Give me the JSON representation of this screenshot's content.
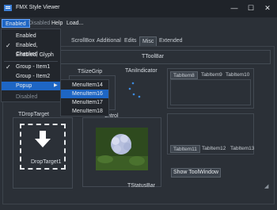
{
  "window": {
    "title": "FMX Style Viewer",
    "controls": {
      "minimize": "—",
      "maximize": "☐",
      "close": "✕"
    }
  },
  "menubar": [
    {
      "label": "Enabled"
    },
    {
      "label": "Disabled"
    },
    {
      "label": "Help"
    },
    {
      "label": "Load..."
    }
  ],
  "dropdown": {
    "items": [
      {
        "label": "Enabled",
        "checked": false
      },
      {
        "label": "Enabled, Checked",
        "checked": true
      },
      {
        "label": "Enabled, Glyph",
        "checked": false
      },
      {
        "label": "Group - Item1",
        "checked": true
      },
      {
        "label": "Group - Item2",
        "checked": false
      },
      {
        "label": "Popup",
        "arrow": "▶"
      },
      {
        "label": "Disabled"
      }
    ],
    "submenu": [
      "MenuItem14",
      "MenuItem16",
      "MenuItem17",
      "MenuItem18"
    ]
  },
  "tabs": [
    "ScrollBox",
    "Additional",
    "Edits",
    "Misc",
    "Extended"
  ],
  "panels": {
    "toolbar": "TToolBar",
    "sizegrip": "TSizeGrip",
    "aniindicator": "TAniIndicator",
    "droptarget_title": "TDropTarget",
    "droptarget_label": "DropTarget1",
    "control_title": "ontrol",
    "statusbar": "TStatusBar"
  },
  "tabcontrol_top": [
    "TabItem8",
    "TabItem9",
    "TabItem10"
  ],
  "tabcontrol_bottom": [
    "TabItem11",
    "TabItem12",
    "TabItem13"
  ],
  "buttons": {
    "show_tool_window": "Show ToolWindow"
  },
  "colors": {
    "accent": "#1e66c4",
    "background": "#2b3037",
    "titlebar": "#1f2329"
  }
}
